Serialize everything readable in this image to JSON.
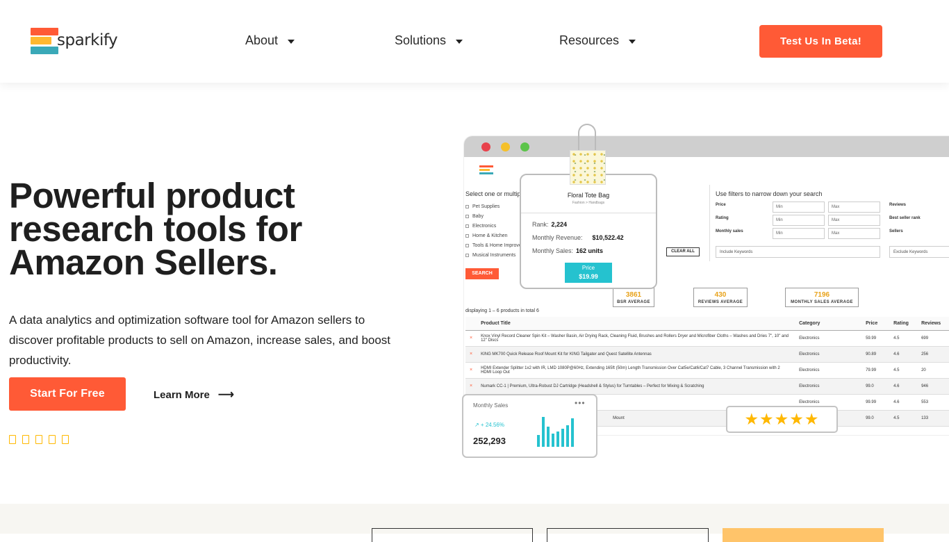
{
  "header": {
    "logo_text": "sparkify",
    "nav": [
      {
        "label": "About"
      },
      {
        "label": "Solutions"
      },
      {
        "label": "Resources"
      }
    ],
    "cta_label": "Test Us In Beta!"
  },
  "hero": {
    "title": "Powerful product research tools for Amazon Sellers.",
    "description": "A data analytics and optimization software tool for Amazon sellers to discover profitable products to sell on Amazon, increase sales, and boost productivity.",
    "primary_button": "Start For Free",
    "secondary_link": "Learn More",
    "secondary_arrow": "⟶",
    "rating_icon_count": 5
  },
  "mockup": {
    "window_dots": [
      "#e8424c",
      "#f5c02a",
      "#5cc44a"
    ],
    "select_title": "Select one or multiple categories",
    "categories": [
      "Pet Supplies",
      "Baby",
      "Electronics",
      "Home & Kitchen",
      "Tools & Home Improvement",
      "Musical Instruments"
    ],
    "filter_title": "Use filters to narrow down your search",
    "filters": {
      "price": "Price",
      "rating": "Rating",
      "monthly_sales": "Monthly sales",
      "min": "Min",
      "max": "Max",
      "reviews": "Reviews",
      "best_seller_rank": "Best seller rank",
      "sellers": "Sellers"
    },
    "include_keywords": "Include Keywords",
    "exclude_keywords": "Exclude Keywords",
    "clear_all": "CLEAR ALL",
    "search": "SEARCH",
    "stats": [
      {
        "value": "3861",
        "label": "BSR AVERAGE"
      },
      {
        "value": "430",
        "label": "REVIEWS AVERAGE"
      },
      {
        "value": "7196",
        "label": "MONTHLY SALES AVERAGE"
      }
    ],
    "displaying": "displaying 1 – 6 products in total 6",
    "table_headers": [
      "Product Title",
      "Category",
      "Price",
      "Rating",
      "Reviews"
    ],
    "rows": [
      {
        "title": "Knox Vinyl Record Cleaner Spin Kit – Washer Basin, Air Drying Rack, Cleaning Fluid, Brushes and Rollers Dryer and Microfiber Cloths – Washes and Dries 7\", 10\" and 12\" Discs",
        "category": "Electronics",
        "price": "59.99",
        "rating": "4.5",
        "reviews": "699"
      },
      {
        "title": "KING MK700 Quick Release Roof Mount Kit for KING Tailgater and Quest Satellite Antennas",
        "category": "Electronics",
        "price": "90.89",
        "rating": "4.6",
        "reviews": "256"
      },
      {
        "title": "HDMI Extender Splitter 1x2 with IR, LMD 1080P@60Hz, Extending 165ft (50m) Length Transmission Over Cat5e/Cat6/Cat7 Cable, 3 Channel Transmission with 2 HDMI Loop Out",
        "category": "Electronics",
        "price": "79.99",
        "rating": "4.5",
        "reviews": "20"
      },
      {
        "title": "Numark CC-1 | Premium, Ultra-Robust DJ Cartridge (Headshell & Stylus) for Turntables – Perfect for Mixing & Scratching",
        "category": "Electronics",
        "price": "99.0",
        "rating": "4.6",
        "reviews": "946"
      },
      {
        "title": "",
        "category": "Electronics",
        "price": "99.99",
        "rating": "4.6",
        "reviews": "553"
      },
      {
        "title": "Mount",
        "category": "Electronics",
        "price": "99.0",
        "rating": "4.5",
        "reviews": "133"
      }
    ],
    "tote": {
      "name": "Floral Tote Bag",
      "sub": "Fashion > Handbags",
      "rank_label": "Rank:",
      "rank": "2,224",
      "revenue_label": "Monthly Revenue:",
      "revenue": "$10,522.42",
      "sales_label": "Monthly Sales:",
      "sales": "162 units",
      "price_label": "Price",
      "price": "$19.99"
    },
    "monthly_sales_card": {
      "title": "Monthly Sales",
      "dots": "•••",
      "change": "↗  + 24.56%",
      "value": "252,293",
      "bars": [
        0.35,
        0.9,
        0.6,
        0.4,
        0.45,
        0.55,
        0.65,
        0.85
      ]
    },
    "rating_stars": "★★★★★"
  },
  "colors": {
    "accent": "#ff5a36",
    "teal": "#25c2cf",
    "star": "#ffb800"
  }
}
